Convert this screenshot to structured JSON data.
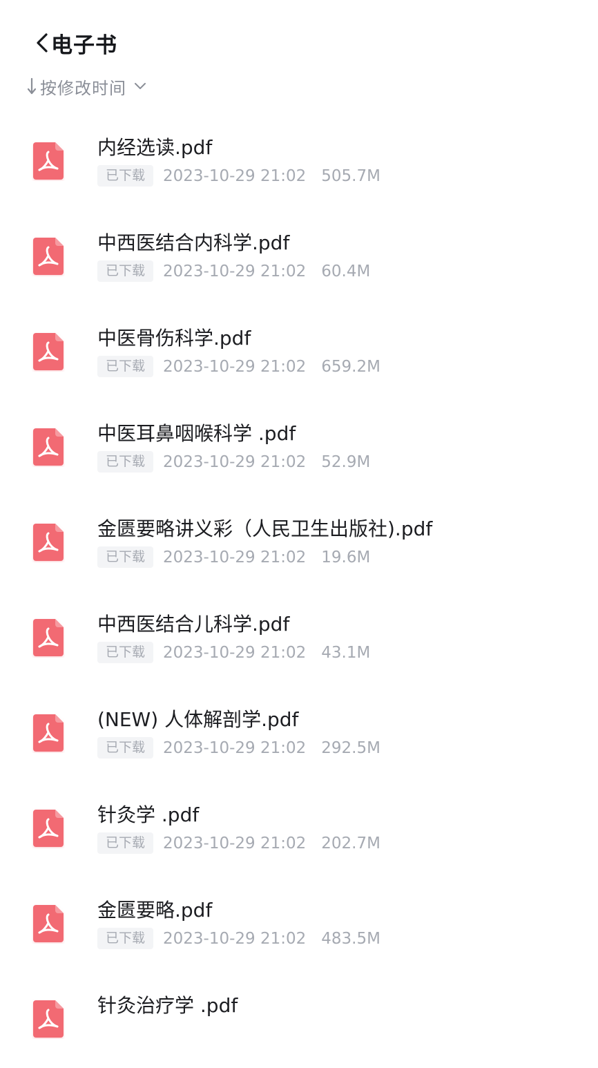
{
  "header": {
    "back_icon": "chevron-left-icon",
    "title": "电子书"
  },
  "sort": {
    "arrow_icon": "arrow-down-icon",
    "label": "按修改时间",
    "chevron_icon": "chevron-down-icon"
  },
  "colors": {
    "pdf_icon": "#f26a73",
    "title_text": "#16181c",
    "meta_text": "#a6aab2",
    "badge_bg": "#f3f4f6"
  },
  "files": [
    {
      "name": "内经选读.pdf",
      "status": "已下载",
      "date": "2023-10-29 21:02",
      "size": "505.7M",
      "icon": "pdf-icon"
    },
    {
      "name": "中西医结合内科学.pdf",
      "status": "已下载",
      "date": "2023-10-29 21:02",
      "size": "60.4M",
      "icon": "pdf-icon"
    },
    {
      "name": "中医骨伤科学.pdf",
      "status": "已下载",
      "date": "2023-10-29 21:02",
      "size": "659.2M",
      "icon": "pdf-icon"
    },
    {
      "name": "中医耳鼻咽喉科学 .pdf",
      "status": "已下载",
      "date": "2023-10-29 21:02",
      "size": "52.9M",
      "icon": "pdf-icon"
    },
    {
      "name": "金匮要略讲义彩（人民卫生出版社).pdf",
      "status": "已下载",
      "date": "2023-10-29 21:02",
      "size": "19.6M",
      "icon": "pdf-icon"
    },
    {
      "name": "中西医结合儿科学.pdf",
      "status": "已下载",
      "date": "2023-10-29 21:02",
      "size": "43.1M",
      "icon": "pdf-icon"
    },
    {
      "name": "(NEW) 人体解剖学.pdf",
      "status": "已下载",
      "date": "2023-10-29 21:02",
      "size": "292.5M",
      "icon": "pdf-icon"
    },
    {
      "name": "针灸学 .pdf",
      "status": "已下载",
      "date": "2023-10-29 21:02",
      "size": "202.7M",
      "icon": "pdf-icon"
    },
    {
      "name": "金匮要略.pdf",
      "status": "已下载",
      "date": "2023-10-29 21:02",
      "size": "483.5M",
      "icon": "pdf-icon"
    },
    {
      "name": "针灸治疗学 .pdf",
      "status": "",
      "date": "",
      "size": "",
      "icon": "pdf-icon"
    }
  ]
}
